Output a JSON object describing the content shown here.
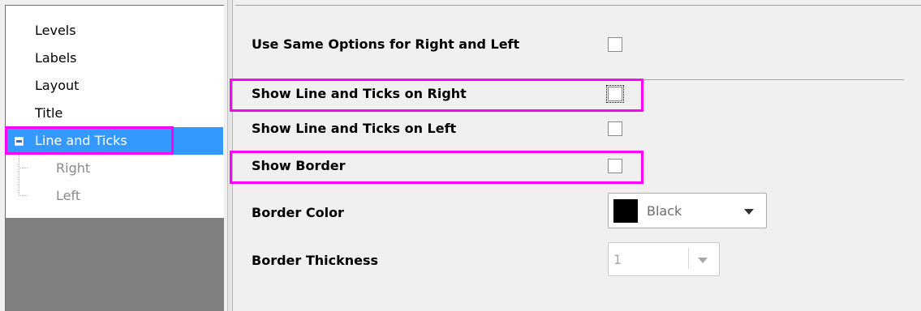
{
  "tree": {
    "items": [
      {
        "label": "Levels"
      },
      {
        "label": "Labels"
      },
      {
        "label": "Layout"
      },
      {
        "label": "Title"
      },
      {
        "label": "Line and Ticks",
        "selected": true,
        "expanded": true
      },
      {
        "label": "Right"
      },
      {
        "label": "Left"
      }
    ]
  },
  "options": {
    "same_options_label": "Use Same Options for Right and Left",
    "same_options_checked": false,
    "show_right_label": "Show Line and Ticks on Right",
    "show_right_checked": false,
    "show_left_label": "Show Line and Ticks on Left",
    "show_left_checked": false,
    "show_border_label": "Show Border",
    "show_border_checked": false,
    "border_color_label": "Border Color",
    "border_color_value": "Black",
    "border_color_swatch": "#000000",
    "border_thickness_label": "Border Thickness",
    "border_thickness_value": "1"
  },
  "colors": {
    "selection": "#3399ff",
    "highlight": "#ff00ff",
    "panel_gray": "#808080"
  }
}
